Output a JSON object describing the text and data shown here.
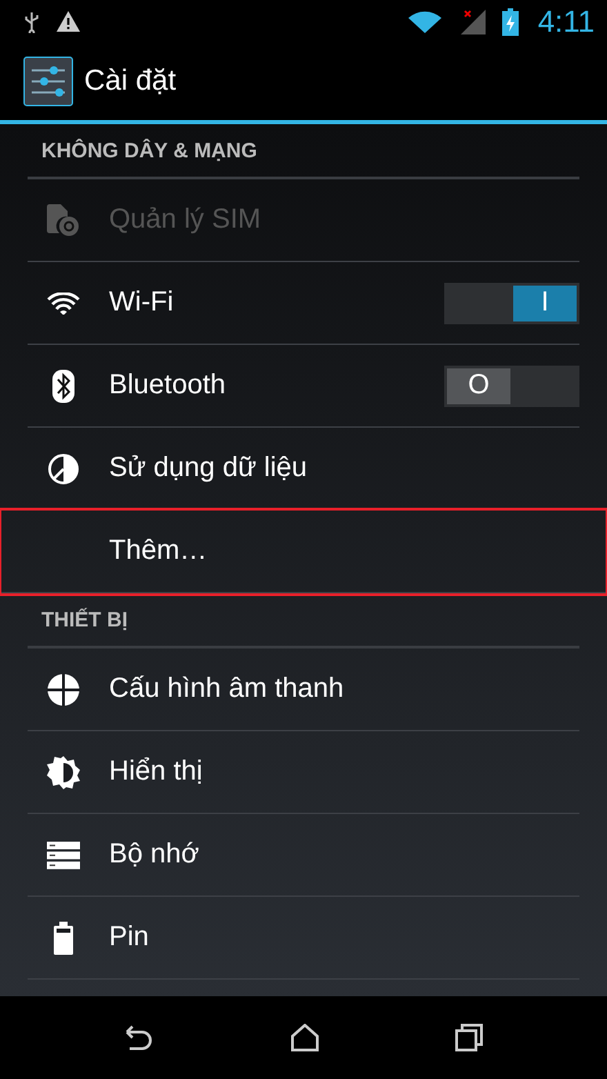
{
  "status_bar": {
    "time": "4:11"
  },
  "action_bar": {
    "title": "Cài đặt"
  },
  "sections": [
    {
      "title": "KHÔNG DÂY & MẠNG",
      "items": [
        {
          "label": "Quản lý SIM",
          "kind": "item",
          "disabled": true,
          "highlighted": false
        },
        {
          "label": "Wi-Fi",
          "kind": "toggle",
          "disabled": false,
          "highlighted": false,
          "on": true,
          "thumb_text": "I"
        },
        {
          "label": "Bluetooth",
          "kind": "toggle",
          "disabled": false,
          "highlighted": false,
          "on": false,
          "thumb_text": "O"
        },
        {
          "label": "Sử dụng dữ liệu",
          "kind": "item",
          "disabled": false,
          "highlighted": false
        },
        {
          "label": "Thêm…",
          "kind": "item",
          "disabled": false,
          "highlighted": true
        }
      ]
    },
    {
      "title": "THIẾT BỊ",
      "items": [
        {
          "label": "Cấu hình âm thanh",
          "kind": "item",
          "disabled": false,
          "highlighted": false
        },
        {
          "label": "Hiển thị",
          "kind": "item",
          "disabled": false,
          "highlighted": false
        },
        {
          "label": "Bộ nhớ",
          "kind": "item",
          "disabled": false,
          "highlighted": false
        },
        {
          "label": "Pin",
          "kind": "item",
          "disabled": false,
          "highlighted": false
        }
      ]
    }
  ]
}
